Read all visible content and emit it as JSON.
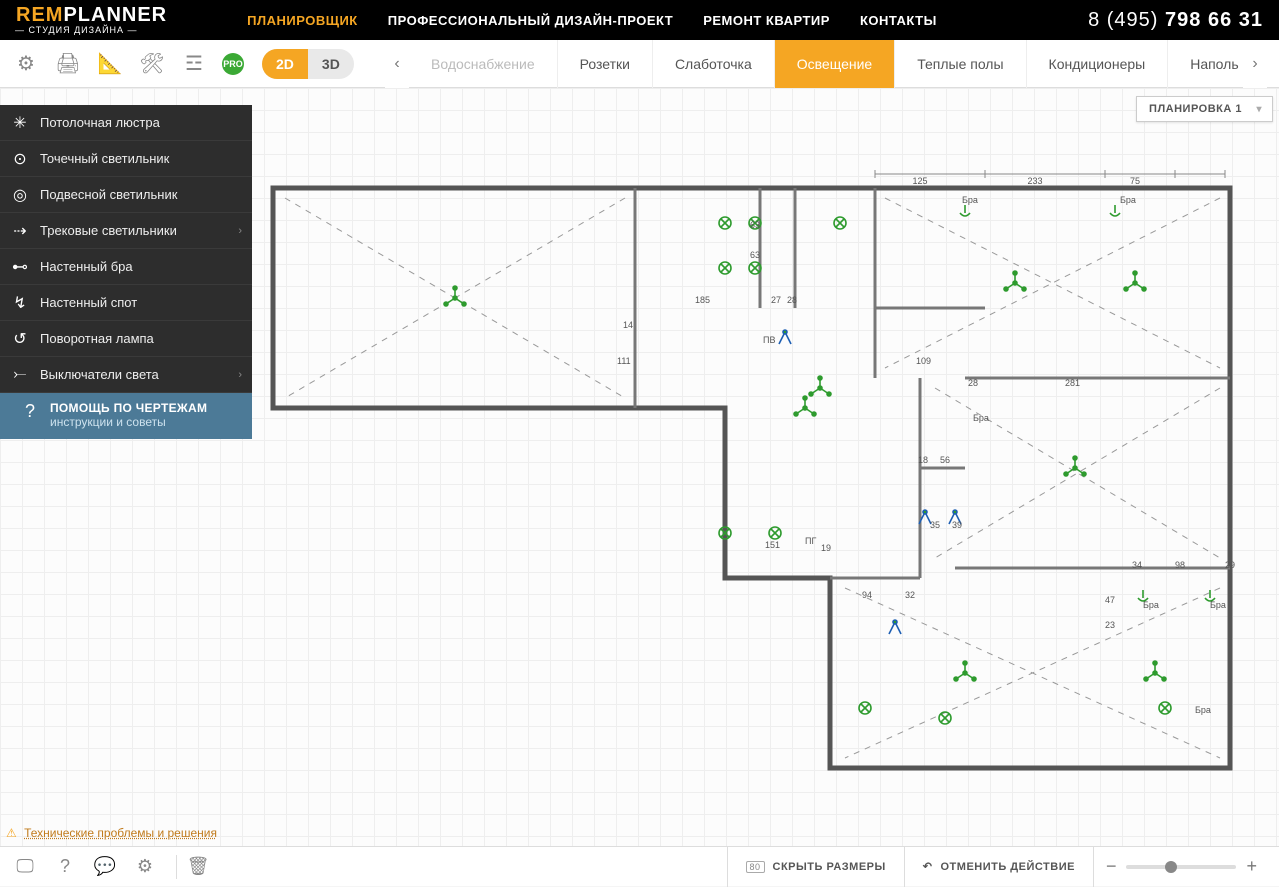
{
  "logo": {
    "rem": "REM",
    "planner": "PLANNER",
    "sub": "— СТУДИЯ ДИЗАЙНА —"
  },
  "nav": [
    {
      "label": "ПЛАНИРОВЩИК",
      "active": true
    },
    {
      "label": "ПРОФЕССИОНАЛЬНЫЙ ДИЗАЙН-ПРОЕКТ"
    },
    {
      "label": "РЕМОНТ КВАРТИР"
    },
    {
      "label": "КОНТАКТЫ"
    }
  ],
  "phone": {
    "pre": "8 (495) ",
    "num": "798 66 31"
  },
  "toolbar": {
    "pro": "PRO",
    "view2d": "2D",
    "view3d": "3D"
  },
  "tabs": [
    {
      "label": "Водоснабжение",
      "dim": true
    },
    {
      "label": "Розетки"
    },
    {
      "label": "Слаботочка"
    },
    {
      "label": "Освещение",
      "active": true
    },
    {
      "label": "Теплые полы"
    },
    {
      "label": "Кондиционеры"
    },
    {
      "label": "Напольные",
      "cut": "Наполь"
    }
  ],
  "layout_label": "ПЛАНИРОВКА 1",
  "sidebar": [
    {
      "icon": "✳",
      "label": "Потолочная люстра"
    },
    {
      "icon": "⊙",
      "label": "Точечный светильник"
    },
    {
      "icon": "◎",
      "label": "Подвесной светильник"
    },
    {
      "icon": "⇢",
      "label": "Трековые светильники",
      "arrow": true
    },
    {
      "icon": "⊷",
      "label": "Настенный бра"
    },
    {
      "icon": "↯",
      "label": "Настенный спот"
    },
    {
      "icon": "↺",
      "label": "Поворотная лампа"
    },
    {
      "icon": "⤚",
      "label": "Выключатели света",
      "arrow": true
    }
  ],
  "help": {
    "title": "ПОМОЩЬ ПО ЧЕРТЕЖАМ",
    "sub": "инструкции и советы",
    "icon": "?"
  },
  "tech": "Технические проблемы и решения",
  "bottom": {
    "size_badge": "80",
    "hide_sizes": "СКРЫТЬ РАЗМЕРЫ",
    "undo": "ОТМЕНИТЬ ДЕЙСТВИЕ"
  },
  "plan_dims": {
    "top": [
      [
        "125",
        655,
        8
      ],
      [
        "233",
        770,
        8
      ],
      [
        "75",
        870,
        8
      ]
    ],
    "labels": [
      [
        "63",
        485,
        60
      ],
      [
        "63",
        485,
        90
      ],
      [
        "185",
        430,
        135
      ],
      [
        "27",
        506,
        135
      ],
      [
        "28",
        522,
        135
      ],
      [
        "14",
        358,
        160
      ],
      [
        "111",
        352,
        196
      ],
      [
        "ПВ",
        498,
        175
      ],
      [
        "109",
        651,
        196
      ],
      [
        "28",
        703,
        218
      ],
      [
        "281",
        800,
        218
      ],
      [
        "Бра",
        708,
        253
      ],
      [
        "18",
        653,
        295
      ],
      [
        "56",
        675,
        295
      ],
      [
        "35",
        665,
        360
      ],
      [
        "39",
        687,
        360
      ],
      [
        "151",
        500,
        380
      ],
      [
        "ПГ",
        540,
        376
      ],
      [
        "19",
        556,
        383
      ],
      [
        "94",
        597,
        430
      ],
      [
        "32",
        640,
        430
      ],
      [
        "34",
        867,
        400
      ],
      [
        "98",
        910,
        400
      ],
      [
        "29",
        960,
        400
      ],
      [
        "Бра",
        878,
        440
      ],
      [
        "Бра",
        945,
        440
      ],
      [
        "47",
        840,
        435
      ],
      [
        "23",
        840,
        460
      ],
      [
        "Бра",
        697,
        35
      ],
      [
        "Бра",
        855,
        35
      ],
      [
        "Бра",
        930,
        545
      ]
    ]
  }
}
